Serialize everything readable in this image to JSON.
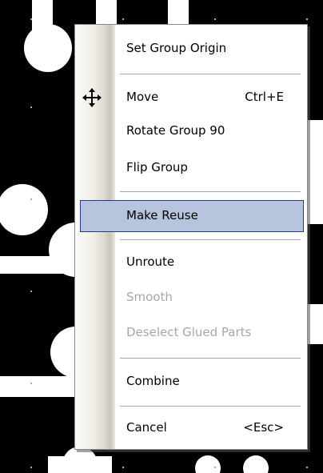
{
  "menu": {
    "items": [
      {
        "label": "Set Group Origin"
      },
      {
        "label": "Move",
        "shortcut": "Ctrl+E",
        "icon": "move-arrows-icon"
      },
      {
        "label": "Rotate Group 90"
      },
      {
        "label": "Flip Group"
      },
      {
        "label": "Make Reuse",
        "state": "highlighted"
      },
      {
        "label": "Unroute"
      },
      {
        "label": "Smooth",
        "state": "disabled"
      },
      {
        "label": "Deselect Glued Parts",
        "state": "disabled"
      },
      {
        "label": "Combine"
      },
      {
        "label": "Cancel",
        "shortcut": "<Esc>"
      }
    ]
  },
  "colors": {
    "background": "#000000",
    "menu_background": "#ffffff",
    "highlight_fill": "#b7c4dd",
    "highlight_border": "#2a3a85",
    "disabled_text": "#a7a6aa"
  }
}
